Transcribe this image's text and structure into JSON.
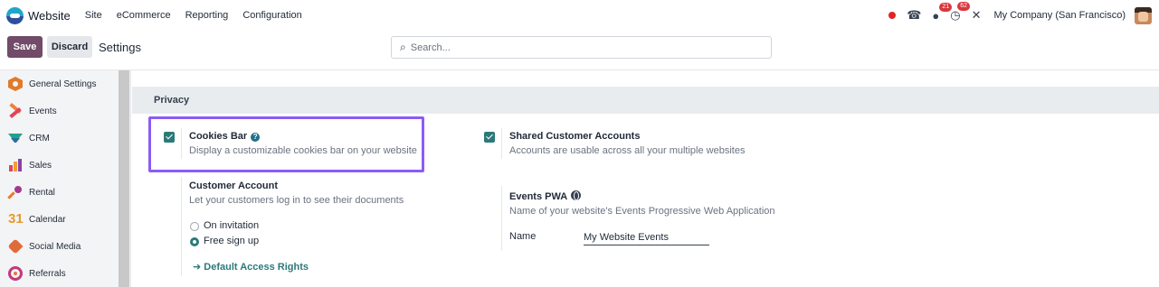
{
  "topnav": {
    "app_name": "Website",
    "menu": [
      "Site",
      "eCommerce",
      "Reporting",
      "Configuration"
    ],
    "messages_count": "21",
    "activities_count": "62",
    "company": "My Company (San Francisco)"
  },
  "control_panel": {
    "save_label": "Save",
    "discard_label": "Discard",
    "title": "Settings",
    "search_placeholder": "Search..."
  },
  "sidebar": {
    "items": [
      {
        "label": "General Settings",
        "icon": "general-settings-icon"
      },
      {
        "label": "Events",
        "icon": "events-icon"
      },
      {
        "label": "CRM",
        "icon": "crm-icon"
      },
      {
        "label": "Sales",
        "icon": "sales-icon"
      },
      {
        "label": "Rental",
        "icon": "rental-icon"
      },
      {
        "label": "Calendar",
        "icon": "calendar-icon"
      },
      {
        "label": "Social Media",
        "icon": "social-media-icon"
      },
      {
        "label": "Referrals",
        "icon": "referrals-icon"
      }
    ]
  },
  "privacy": {
    "title": "Privacy",
    "cookies_bar": {
      "title": "Cookies Bar",
      "description": "Display a customizable cookies bar on your website",
      "checked": true
    },
    "shared_accounts": {
      "title": "Shared Customer Accounts",
      "description": "Accounts are usable across all your multiple websites",
      "checked": true
    },
    "customer_account": {
      "title": "Customer Account",
      "description": "Let your customers log in to see their documents",
      "options": [
        "On invitation",
        "Free sign up"
      ],
      "selected": "Free sign up",
      "link": "Default Access Rights"
    },
    "events_pwa": {
      "title": "Events PWA",
      "description": "Name of your website's Events Progressive Web Application",
      "field_label": "Name",
      "field_value": "My Website Events"
    }
  },
  "colors": {
    "primary": "#714b67",
    "accent": "#2b7a78",
    "highlight": "#8b5cf6",
    "badge": "#d9383e"
  }
}
